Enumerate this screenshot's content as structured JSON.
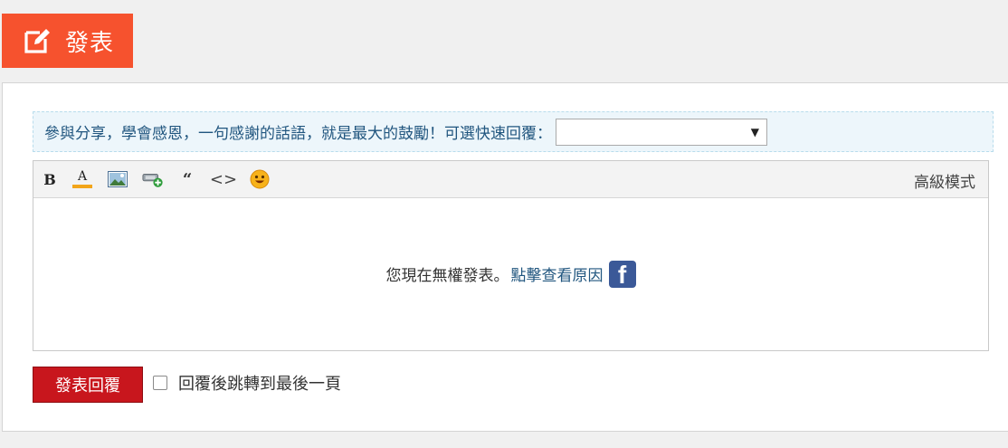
{
  "post_button": {
    "label": "發表",
    "bg_color": "#f6522e"
  },
  "notice": {
    "text": "參與分享，學會感恩，一句感謝的話語，就是最大的鼓勵！可選快速回覆：",
    "quick_reply": {
      "value": "",
      "arrow": "▼"
    }
  },
  "toolbar": {
    "bold": "B",
    "color": "A",
    "quote": "“",
    "code": "<>",
    "advanced_mode": "高級模式",
    "icons": [
      "bold-icon",
      "font-color-icon",
      "image-icon",
      "link-icon",
      "quote-icon",
      "code-icon",
      "smiley-icon"
    ]
  },
  "editor": {
    "message": "您現在無權發表。",
    "link_text": "點擊查看原因",
    "fb_glyph": "f"
  },
  "footer": {
    "submit_label": "發表回覆",
    "checkbox_label": "回覆後跳轉到最後一頁"
  },
  "colors": {
    "accent": "#f6522e",
    "submit": "#c8161d",
    "link": "#21567f",
    "notice_bg": "#edf6fb"
  }
}
